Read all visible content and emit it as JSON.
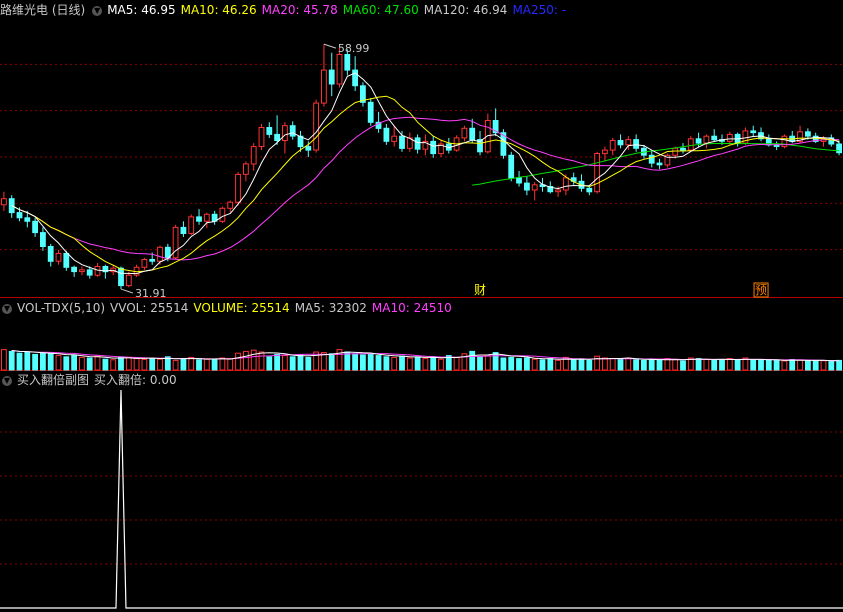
{
  "main_panel": {
    "title": "路维光电 (日线)",
    "ma_items": [
      {
        "label": "MA5: 46.95",
        "color": "#ffffff"
      },
      {
        "label": "MA10: 46.26",
        "color": "#ffff00"
      },
      {
        "label": "MA20: 45.78",
        "color": "#ff40ff"
      },
      {
        "label": "MA60: 47.60",
        "color": "#00e000"
      },
      {
        "label": "MA120: 46.94",
        "color": "#c8c8c8"
      },
      {
        "label": "MA250: -",
        "color": "#2828ff"
      }
    ],
    "high_label": "58.99",
    "low_label": "31.91",
    "event_markers": [
      {
        "text": "财",
        "color": "#ffff00",
        "box": false,
        "x_index": 61
      },
      {
        "text": "预",
        "color": "#ff8000",
        "box": true,
        "x_index": 97
      }
    ]
  },
  "volume_panel": {
    "title": "VOL-TDX(5,10)",
    "items": [
      {
        "label": "VVOL: 25514",
        "color": "#c8c8c8"
      },
      {
        "label": "VOLUME: 25514",
        "color": "#ffff00"
      },
      {
        "label": "MA5: 32302",
        "color": "#c8c8c8"
      },
      {
        "label": "MA10: 24510",
        "color": "#ff40ff"
      }
    ]
  },
  "indicator_panel": {
    "title": "买入翻倍副图",
    "value_label": "买入翻倍: 0.00"
  },
  "colors": {
    "up": "#ff3232",
    "down": "#54ffff",
    "grid": "#8b0000",
    "ma5": "#ffffff",
    "ma10": "#ffff00",
    "ma20": "#ff40ff",
    "ma60": "#00e000"
  },
  "chart_data": [
    {
      "type": "candlestick",
      "title": "路维光电 (日线)",
      "ylim": [
        30,
        62
      ],
      "ohlc": [
        [
          40.5,
          42.0,
          39.8,
          41.2
        ],
        [
          41.2,
          41.6,
          39.0,
          39.6
        ],
        [
          39.6,
          40.2,
          38.6,
          39.0
        ],
        [
          39.0,
          39.8,
          37.9,
          38.6
        ],
        [
          38.6,
          39.0,
          36.8,
          37.3
        ],
        [
          37.3,
          37.9,
          35.2,
          35.7
        ],
        [
          35.7,
          36.0,
          33.4,
          34.0
        ],
        [
          34.0,
          35.3,
          33.6,
          34.9
        ],
        [
          34.9,
          35.2,
          32.9,
          33.3
        ],
        [
          33.3,
          33.5,
          32.2,
          32.8
        ],
        [
          32.8,
          33.4,
          32.4,
          33.0
        ],
        [
          33.0,
          33.4,
          32.0,
          32.4
        ],
        [
          32.4,
          33.8,
          32.2,
          33.4
        ],
        [
          33.4,
          33.6,
          32.0,
          32.8
        ],
        [
          32.8,
          33.6,
          32.4,
          33.2
        ],
        [
          33.2,
          33.4,
          30.8,
          31.2
        ],
        [
          31.2,
          32.8,
          31.0,
          32.4
        ],
        [
          32.4,
          33.6,
          32.2,
          33.3
        ],
        [
          33.3,
          34.4,
          33.0,
          34.2
        ],
        [
          34.2,
          35.0,
          33.6,
          34.0
        ],
        [
          34.0,
          35.8,
          33.6,
          35.6
        ],
        [
          35.6,
          36.0,
          34.0,
          34.4
        ],
        [
          34.4,
          38.2,
          34.2,
          37.9
        ],
        [
          37.9,
          38.6,
          36.8,
          37.2
        ],
        [
          37.2,
          39.4,
          37.0,
          39.1
        ],
        [
          39.1,
          40.0,
          38.2,
          38.6
        ],
        [
          38.6,
          39.6,
          37.8,
          39.4
        ],
        [
          39.4,
          39.8,
          38.2,
          38.6
        ],
        [
          38.6,
          40.3,
          38.4,
          40.1
        ],
        [
          40.1,
          41.0,
          39.6,
          40.8
        ],
        [
          40.8,
          44.3,
          40.4,
          44.0
        ],
        [
          44.0,
          45.5,
          43.2,
          45.2
        ],
        [
          45.2,
          47.6,
          44.4,
          47.2
        ],
        [
          47.2,
          49.8,
          46.8,
          49.4
        ],
        [
          49.4,
          50.0,
          48.2,
          48.6
        ],
        [
          48.6,
          50.8,
          47.4,
          47.9
        ],
        [
          47.9,
          50.0,
          46.4,
          49.6
        ],
        [
          49.6,
          50.1,
          48.0,
          48.4
        ],
        [
          48.4,
          49.0,
          46.6,
          47.2
        ],
        [
          47.2,
          47.8,
          46.0,
          46.8
        ],
        [
          46.8,
          52.6,
          46.5,
          52.2
        ],
        [
          52.2,
          58.99,
          51.8,
          56.0
        ],
        [
          56.0,
          58.0,
          53.0,
          54.4
        ],
        [
          54.4,
          58.6,
          54.0,
          57.8
        ],
        [
          57.8,
          58.4,
          55.4,
          56.0
        ],
        [
          56.0,
          57.6,
          53.6,
          54.2
        ],
        [
          54.2,
          54.6,
          51.8,
          52.3
        ],
        [
          52.3,
          52.8,
          49.6,
          50.0
        ],
        [
          50.0,
          51.2,
          48.8,
          49.3
        ],
        [
          49.3,
          49.8,
          47.4,
          47.8
        ],
        [
          47.8,
          49.6,
          47.2,
          48.4
        ],
        [
          48.4,
          49.0,
          46.6,
          47.0
        ],
        [
          47.0,
          48.8,
          46.6,
          48.2
        ],
        [
          48.2,
          48.6,
          46.4,
          46.9
        ],
        [
          46.9,
          48.6,
          46.2,
          47.8
        ],
        [
          47.8,
          48.4,
          45.9,
          46.4
        ],
        [
          46.4,
          48.0,
          46.0,
          47.5
        ],
        [
          47.5,
          48.2,
          46.4,
          46.8
        ],
        [
          46.8,
          48.5,
          46.6,
          48.2
        ],
        [
          48.2,
          49.6,
          47.8,
          49.3
        ],
        [
          49.3,
          50.4,
          47.6,
          48.0
        ],
        [
          48.0,
          49.0,
          46.2,
          46.6
        ],
        [
          46.6,
          51.0,
          46.4,
          50.2
        ],
        [
          50.2,
          51.6,
          48.4,
          48.8
        ],
        [
          48.8,
          49.2,
          45.8,
          46.2
        ],
        [
          46.2,
          46.6,
          43.2,
          43.6
        ],
        [
          43.6,
          44.4,
          42.6,
          43.0
        ],
        [
          43.0,
          43.8,
          41.6,
          42.2
        ],
        [
          42.2,
          43.1,
          41.0,
          42.8
        ],
        [
          42.8,
          43.6,
          42.0,
          42.6
        ],
        [
          42.6,
          43.2,
          41.8,
          42.0
        ],
        [
          42.0,
          42.6,
          41.4,
          42.2
        ],
        [
          42.2,
          44.0,
          41.6,
          43.6
        ],
        [
          43.6,
          44.2,
          42.8,
          43.2
        ],
        [
          43.2,
          44.0,
          42.0,
          42.4
        ],
        [
          42.4,
          42.8,
          41.6,
          42.0
        ],
        [
          42.0,
          46.6,
          41.8,
          46.4
        ],
        [
          46.4,
          47.2,
          45.6,
          46.8
        ],
        [
          46.8,
          48.2,
          46.2,
          47.9
        ],
        [
          47.9,
          48.6,
          47.0,
          47.4
        ],
        [
          47.4,
          48.4,
          46.8,
          48.0
        ],
        [
          48.0,
          48.6,
          46.6,
          47.0
        ],
        [
          47.0,
          47.4,
          45.8,
          46.2
        ],
        [
          46.2,
          46.8,
          44.8,
          45.3
        ],
        [
          45.3,
          45.8,
          44.6,
          45.1
        ],
        [
          45.1,
          46.4,
          44.8,
          46.2
        ],
        [
          46.2,
          47.2,
          45.8,
          47.0
        ],
        [
          47.0,
          47.6,
          46.4,
          46.8
        ],
        [
          46.8,
          48.4,
          46.6,
          48.1
        ],
        [
          48.1,
          48.8,
          47.2,
          47.6
        ],
        [
          47.6,
          48.6,
          47.0,
          48.4
        ],
        [
          48.4,
          49.2,
          47.8,
          48.0
        ],
        [
          48.0,
          48.6,
          47.4,
          47.8
        ],
        [
          47.8,
          48.9,
          47.4,
          48.6
        ],
        [
          48.6,
          48.8,
          47.2,
          47.6
        ],
        [
          47.6,
          49.4,
          47.4,
          49.0
        ],
        [
          49.0,
          49.6,
          48.4,
          48.8
        ],
        [
          48.8,
          49.4,
          47.8,
          48.1
        ],
        [
          48.1,
          48.6,
          47.2,
          47.4
        ],
        [
          47.4,
          47.8,
          46.8,
          47.2
        ],
        [
          47.2,
          48.6,
          47.0,
          48.4
        ],
        [
          48.4,
          49.0,
          47.6,
          47.8
        ],
        [
          47.8,
          49.6,
          47.6,
          48.9
        ],
        [
          48.9,
          49.3,
          48.0,
          48.4
        ],
        [
          48.4,
          48.8,
          47.6,
          47.8
        ],
        [
          47.8,
          48.4,
          47.2,
          48.2
        ],
        [
          48.2,
          48.6,
          47.2,
          47.5
        ],
        [
          47.5,
          47.9,
          46.2,
          46.5
        ]
      ],
      "high_annotation": 58.99,
      "low_annotation": 31.91
    },
    {
      "type": "bar",
      "title": "VOL-TDX(5,10)",
      "ylim": [
        0,
        90000
      ],
      "volume": [
        34000,
        31000,
        28000,
        30000,
        26000,
        29000,
        27000,
        24000,
        22000,
        25000,
        21000,
        20000,
        23000,
        18000,
        17000,
        22000,
        21000,
        19000,
        17500,
        20000,
        18000,
        22000,
        16000,
        19000,
        21000,
        17000,
        18000,
        17000,
        20000,
        19000,
        28000,
        31000,
        33000,
        30000,
        22000,
        26000,
        24000,
        22000,
        25000,
        21000,
        30000,
        29000,
        27000,
        34000,
        30000,
        27000,
        25000,
        26000,
        24000,
        22000,
        21000,
        23000,
        20000,
        22000,
        19000,
        22000,
        18000,
        24000,
        21000,
        27000,
        31000,
        22000,
        25000,
        29000,
        20000,
        21000,
        19000,
        20000,
        18000,
        17000,
        19000,
        16000,
        21000,
        17000,
        18000,
        16000,
        23000,
        20000,
        19000,
        18000,
        20000,
        17000,
        16000,
        17500,
        16000,
        19000,
        18000,
        15000,
        20000,
        19000,
        18000,
        16000,
        16500,
        19000,
        17000,
        20000,
        16000,
        16000,
        17000,
        16000,
        15000,
        17500,
        16500,
        15000,
        16000,
        15500,
        14000,
        16000
      ]
    },
    {
      "type": "line",
      "title": "买入翻倍副图",
      "spike_index": 15,
      "spike_value": 1
    }
  ]
}
